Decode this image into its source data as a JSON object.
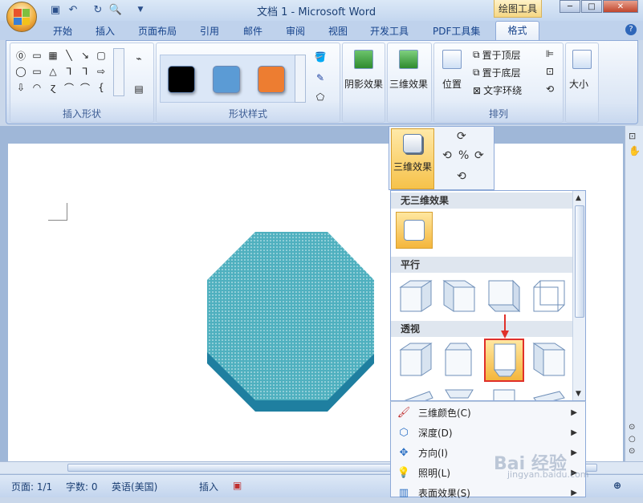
{
  "app": {
    "title": "文档 1 - Microsoft Word",
    "context_tab_group": "绘图工具"
  },
  "tabs": [
    "开始",
    "插入",
    "页面布局",
    "引用",
    "邮件",
    "审阅",
    "视图",
    "开发工具",
    "PDF工具集",
    "格式"
  ],
  "active_tab": "格式",
  "ribbon": {
    "insert_shapes": {
      "label": "插入形状",
      "glyphs": [
        "⓪",
        "▭",
        "▦",
        "╲",
        "↘",
        "▢",
        "◯",
        "▭",
        "△",
        "⅂",
        "⅂",
        "⇨",
        "⇩",
        "◠",
        "ɀ",
        "⌒",
        "⌒",
        "{"
      ]
    },
    "shape_styles": {
      "label": "形状样式",
      "swatches": [
        "#000000",
        "#5b9bd5",
        "#ed7d31"
      ]
    },
    "shadow": {
      "label": "阴影效果"
    },
    "three_d": {
      "label": "三维效果"
    },
    "arrange": {
      "label": "排列",
      "position": "位置",
      "bring_front": "置于顶层",
      "send_back": "置于底层",
      "text_wrap": "文字环绕"
    },
    "size": {
      "label": "大小"
    }
  },
  "dropdown": {
    "header_label": "三维效果",
    "sections": {
      "none": "无三维效果",
      "parallel": "平行",
      "perspective": "透视"
    },
    "menu": [
      {
        "label": "三维颜色(C)",
        "icon": "3d-color-icon"
      },
      {
        "label": "深度(D)",
        "icon": "depth-icon"
      },
      {
        "label": "方向(I)",
        "icon": "direction-icon"
      },
      {
        "label": "照明(L)",
        "icon": "lighting-icon"
      },
      {
        "label": "表面效果(S)",
        "icon": "surface-icon"
      }
    ]
  },
  "status": {
    "page": "页面: 1/1",
    "words": "字数: 0",
    "language": "英语(美国)",
    "mode": "插入"
  },
  "watermark": {
    "main": "Bai 经验",
    "sub": "jingyan.baidu.com"
  },
  "colors": {
    "accent": "#f5b23b",
    "shape_fill": "#4fb0bf",
    "shape_side": "#1f7fa0",
    "selection_border": "#e0302a"
  }
}
